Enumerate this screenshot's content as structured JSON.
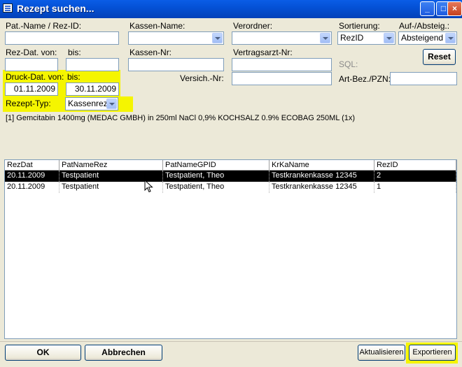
{
  "window": {
    "title": "Rezept suchen...",
    "icon": "document-list-icon"
  },
  "titlebar_buttons": {
    "minimize": "_",
    "maximize": "□",
    "close": "×"
  },
  "labels": {
    "patname": "Pat.-Name / Rez-ID:",
    "kassenname": "Kassen-Name:",
    "verordner": "Verordner:",
    "sortierung": "Sortierung:",
    "aufabsteig": "Auf-/Absteig.:",
    "rezdatvon": "Rez-Dat. von:",
    "bis1": "bis:",
    "kassennr": "Kassen-Nr:",
    "vertragsarztnr": "Vertragsarzt-Nr:",
    "sql": "SQL:",
    "druckdatvon": "Druck-Dat. von:",
    "bis2": "bis:",
    "versichnr": "Versich.-Nr:",
    "artbez": "Art-Bez./PZN:",
    "rezepttyp": "Rezept-Typ:"
  },
  "fields": {
    "patname": "",
    "kassenname": "",
    "verordner": "",
    "sortierung": "RezID",
    "aufabsteig": "Absteigend",
    "rezdatvon": "",
    "rezdatbis": "",
    "kassennr": "",
    "vertragsarztnr": "",
    "druckdatvon": "01.11.2009",
    "druckdatbis": "30.11.2009",
    "versichnr": "",
    "artbez": "",
    "rezepttyp": "Kassenrez"
  },
  "buttons": {
    "reset": "Reset",
    "ok": "OK",
    "abbrechen": "Abbrechen",
    "aktualisieren": "Aktualisieren",
    "exportieren": "Exportieren"
  },
  "info_text": "[1] Gemcitabin 1400mg (MEDAC GMBH) in 250ml NaCl 0,9% KOCHSALZ 0.9% ECOBAG 250ML (1x)",
  "grid": {
    "columns": [
      "RezDat",
      "PatNameRez",
      "PatNameGPID",
      "KrKaName",
      "RezID"
    ],
    "rows": [
      [
        "20.11.2009",
        "Testpatient",
        "Testpatient, Theo",
        "Testkrankenkasse   12345",
        "2"
      ],
      [
        "20.11.2009",
        "Testpatient",
        "Testpatient, Theo",
        "Testkrankenkasse   12345",
        "1"
      ]
    ],
    "selected_row": 0
  },
  "colors": {
    "highlight": "#f5f500",
    "selection": "#000000",
    "titlebar": "#0451d6"
  }
}
